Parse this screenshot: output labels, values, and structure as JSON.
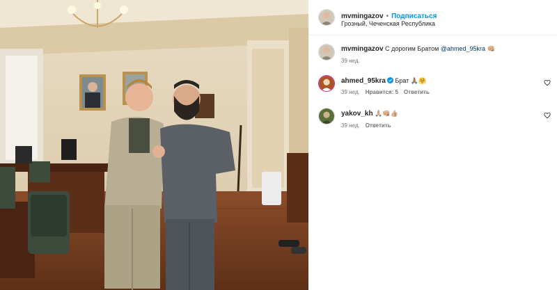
{
  "post": {
    "author": "mvmingazov",
    "separator": "•",
    "follow_label": "Подписаться",
    "location": "Грозный, Чеченская Республика"
  },
  "caption": {
    "username": "mvmingazov",
    "text": "С дорогим Братом",
    "mention": "@ahmed_95kra",
    "emoji": "👊🏼",
    "time": "39 нед."
  },
  "comments": [
    {
      "username": "ahmed_95kra",
      "verified": true,
      "text": "Брат",
      "emoji": "🙏🏽🤗",
      "time": "39 нед.",
      "likes": "Нравится: 5",
      "reply_label": "Ответить",
      "avatar_icon": "avatar-icon"
    },
    {
      "username": "yakov_kh",
      "verified": false,
      "text": "",
      "emoji": "🙏🏼👊🏼👍🏼",
      "time": "39 нед.",
      "likes": "",
      "reply_label": "Ответить",
      "avatar_icon": "avatar-icon"
    }
  ],
  "colors": {
    "accent": "#0095f6",
    "verified": "#0095f6",
    "muted": "#737373"
  }
}
